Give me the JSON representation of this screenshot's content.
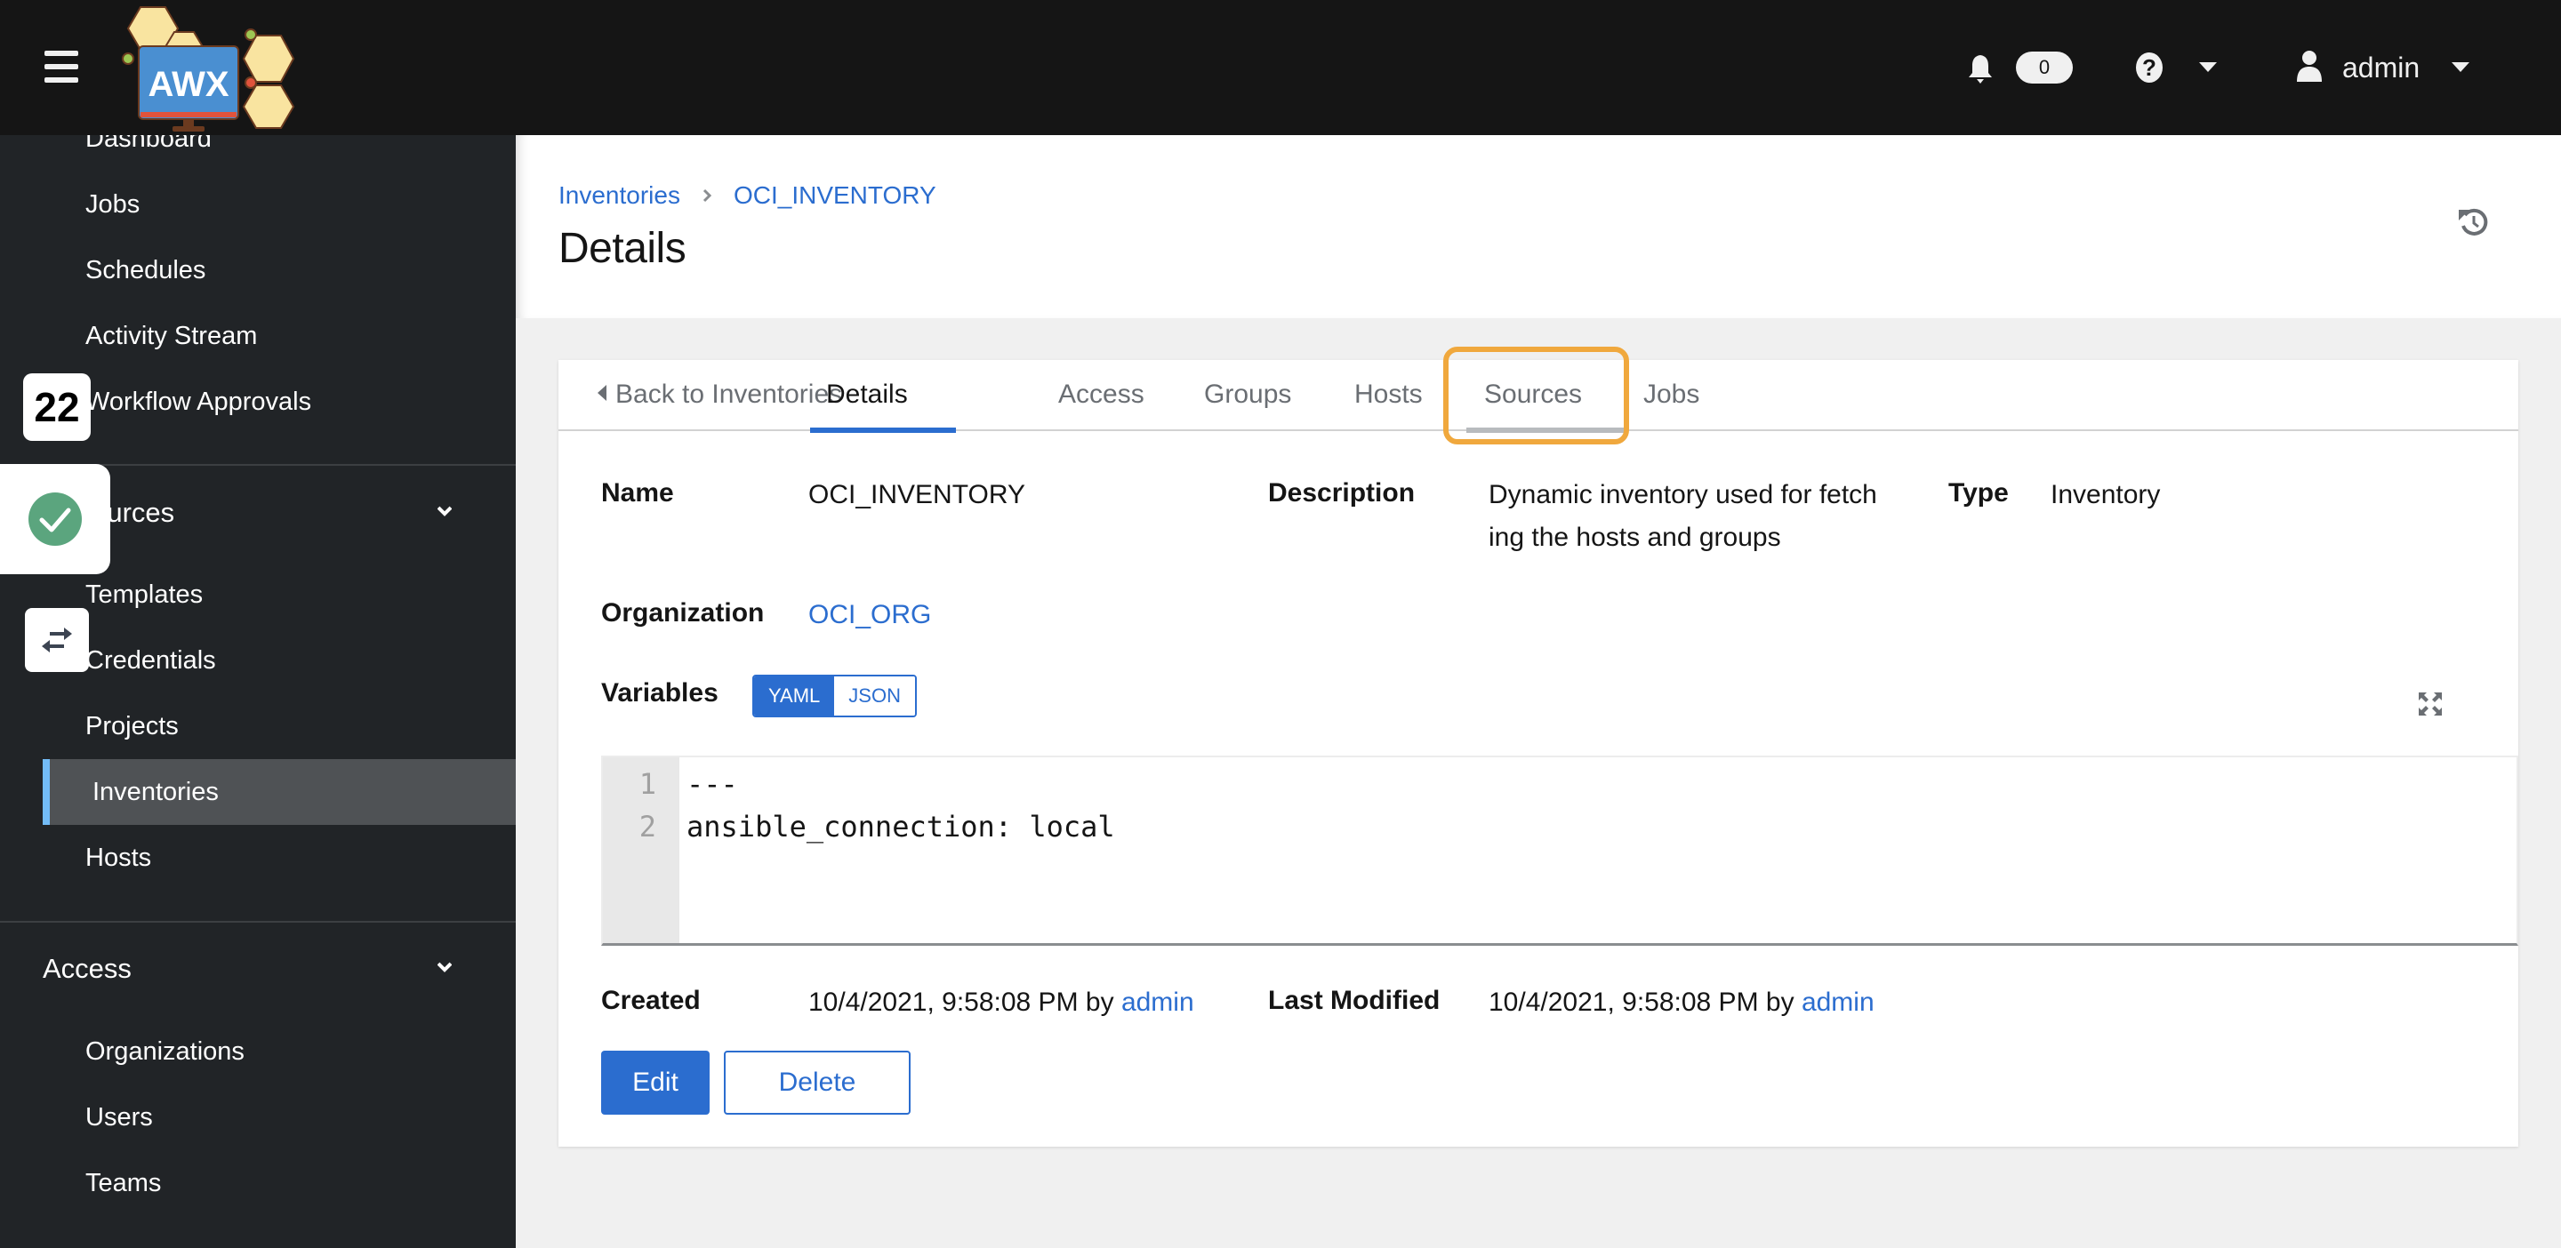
{
  "app": {
    "logo_text": "AWX",
    "notifications_count": "0",
    "user_name": "admin"
  },
  "sidebar": {
    "items_top": [
      {
        "label": "Dashboard"
      },
      {
        "label": "Jobs"
      },
      {
        "label": "Schedules"
      },
      {
        "label": "Activity Stream"
      },
      {
        "label": "Workflow Approvals"
      }
    ],
    "resources_group": {
      "label": "Resources",
      "visible_label": "urces",
      "items": [
        {
          "label": "Templates"
        },
        {
          "label": "Credentials"
        },
        {
          "label": "Projects"
        },
        {
          "label": "Inventories",
          "active": true
        },
        {
          "label": "Hosts"
        }
      ]
    },
    "access_group": {
      "label": "Access",
      "items": [
        {
          "label": "Organizations"
        },
        {
          "label": "Users"
        },
        {
          "label": "Teams"
        }
      ]
    },
    "overlays": {
      "count_badge": "22",
      "status_icon": "check-circle-icon",
      "swap_icon": "swap-arrows-icon"
    }
  },
  "page": {
    "breadcrumb": [
      {
        "label": "Inventories"
      },
      {
        "label": "OCI_INVENTORY"
      }
    ],
    "title": "Details"
  },
  "tabs": [
    {
      "label": "Back to Inventories",
      "type": "back"
    },
    {
      "label": "Details",
      "state": "active"
    },
    {
      "label": "Access"
    },
    {
      "label": "Groups"
    },
    {
      "label": "Hosts"
    },
    {
      "label": "Sources",
      "state": "hover",
      "highlighted": true
    },
    {
      "label": "Jobs"
    }
  ],
  "details": {
    "name_label": "Name",
    "name_value": "OCI_INVENTORY",
    "description_label": "Description",
    "description_value": "Dynamic inventory used for fetching the hosts and groups",
    "description_line1": "Dynamic inventory used for fetch",
    "description_line2": "ing the hosts and groups",
    "type_label": "Type",
    "type_value": "Inventory",
    "organization_label": "Organization",
    "organization_value": "OCI_ORG",
    "variables_label": "Variables",
    "variables_format_options": [
      "YAML",
      "JSON"
    ],
    "variables_format_selected": "YAML",
    "variables_lines": [
      {
        "number": "1",
        "text": "---"
      },
      {
        "number": "2",
        "text": "ansible_connection: local"
      }
    ],
    "created_label": "Created",
    "created_value": "10/4/2021, 9:58:08 PM by",
    "created_by": "admin",
    "modified_label": "Last Modified",
    "modified_value": "10/4/2021, 9:58:08 PM by",
    "modified_by": "admin"
  },
  "actions": {
    "edit_label": "Edit",
    "delete_label": "Delete"
  },
  "colors": {
    "accent": "#2b6dcf",
    "header_bg": "#151515",
    "sidebar_bg": "#212427",
    "active_indicator": "#73bcf7",
    "highlight_box": "#f0a83d",
    "success": "#5ba57e"
  }
}
